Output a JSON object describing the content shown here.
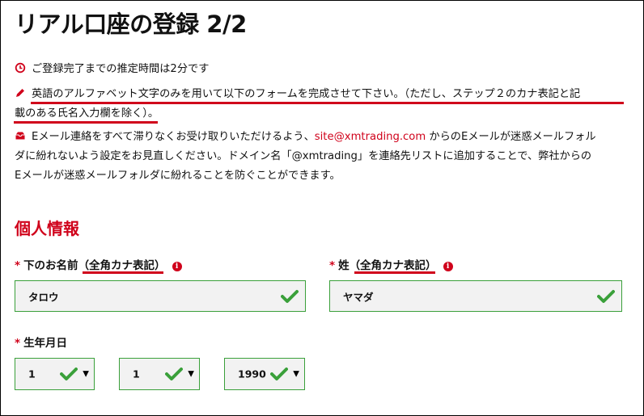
{
  "page": {
    "title": "リアル口座の登録 2/2"
  },
  "notes": {
    "time_estimate": "ご登録完了までの推定時間は2分です",
    "instruction_line1": "英語のアルファベット文字のみを用いて以下のフォームを完成させて下さい。（ただし、ステップ２のカナ表記と記",
    "instruction_line2": "載のある氏名入力欄を除く）",
    "instruction_tail": "。",
    "email_pre": "Eメール連絡をすべて滞りなくお受け取りいただけるよう、",
    "email_address": "site@xmtrading.com",
    "email_post1": " からのEメールが迷惑メールフォル",
    "email_line2": "ダに紛れないよう設定をお見直しください。ドメイン名「@xmtrading」を連絡先リストに追加することで、弊社からの",
    "email_line3": "Eメールが迷惑メールフォルダに紛れることを防ぐことができます。"
  },
  "section": {
    "title": "個人情報"
  },
  "form": {
    "required_mark": "*",
    "info_glyph": "i",
    "first_name": {
      "label": "下のお名前",
      "label_hint": "（全角カナ表記）",
      "value": "タロウ"
    },
    "last_name": {
      "label": "姓",
      "label_hint": "（全角カナ表記）",
      "value": "ヤマダ"
    },
    "birthdate": {
      "label": "生年月日",
      "day": "1",
      "month": "1",
      "year": "1990"
    }
  },
  "colors": {
    "accent_red": "#d0021b",
    "valid_green": "#3aa03a"
  },
  "icons": [
    "clock-icon",
    "pencil-icon",
    "envelope-icon",
    "info-icon",
    "checkmark-icon",
    "caret-down-icon"
  ]
}
